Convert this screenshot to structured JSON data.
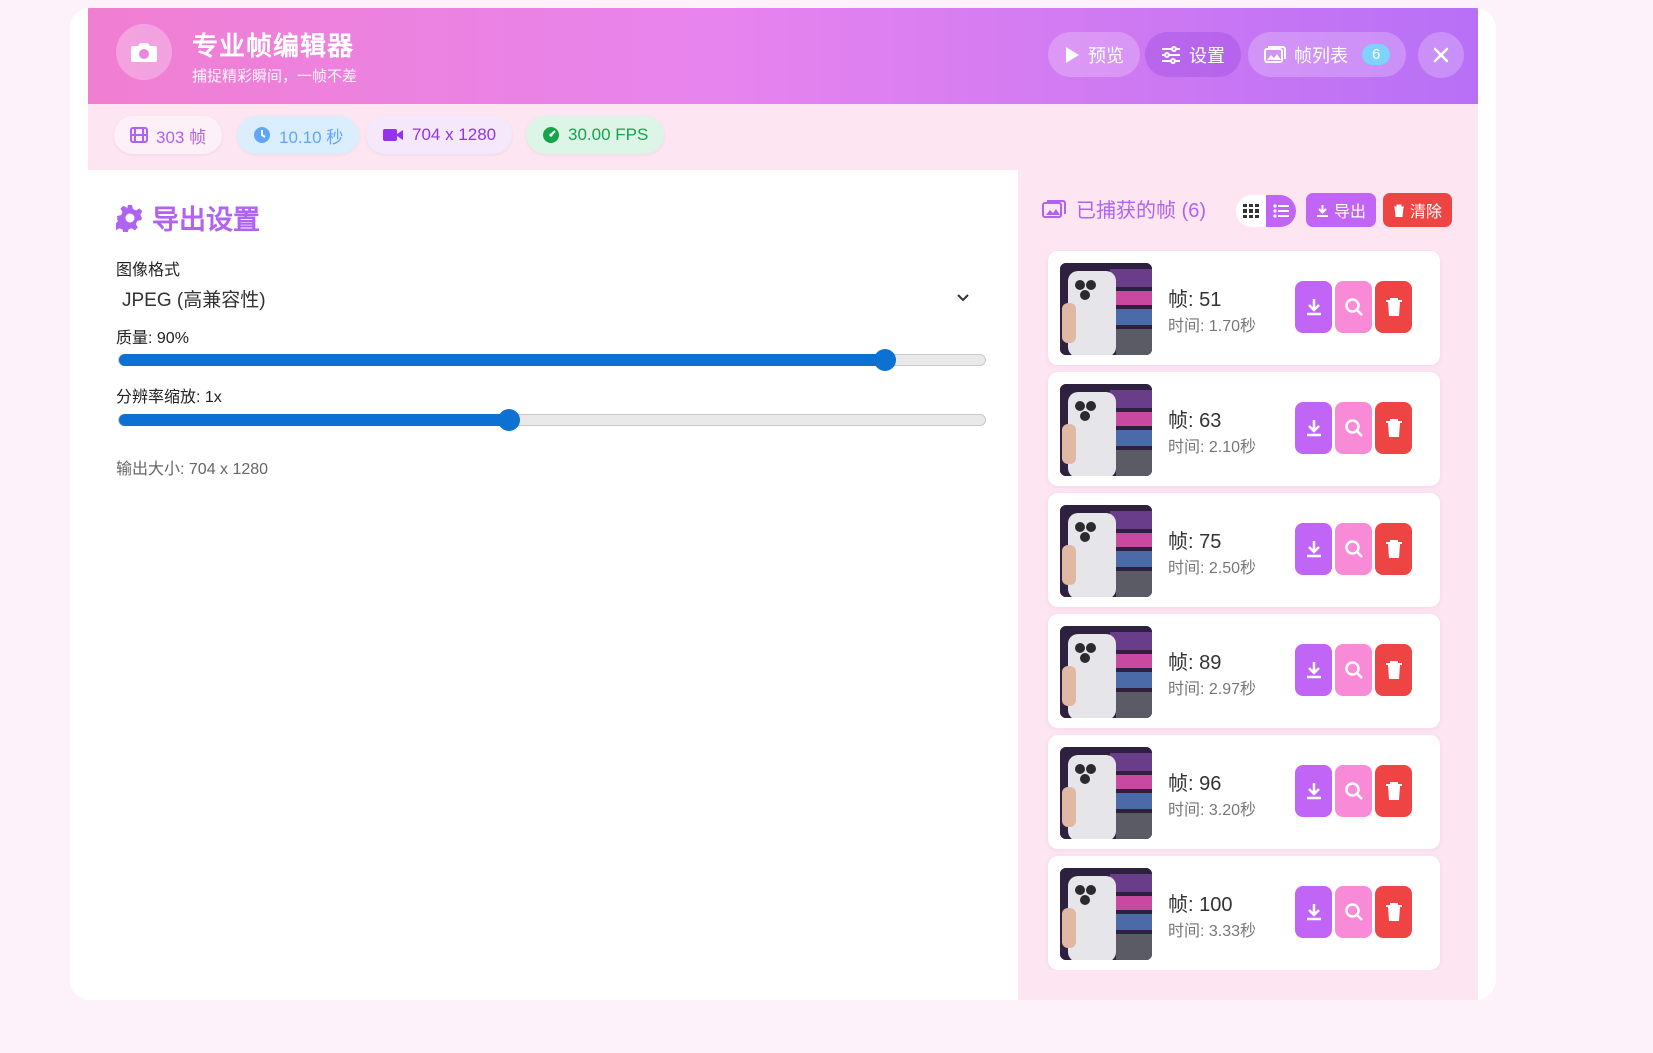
{
  "header": {
    "title": "专业帧编辑器",
    "subtitle": "捕捉精彩瞬间，一帧不差",
    "buttons": {
      "preview": "预览",
      "settings": "设置",
      "frame_list": "帧列表",
      "frame_count": "6"
    }
  },
  "stats": {
    "frames": "303 帧",
    "duration": "10.10 秒",
    "resolution": "704 x 1280",
    "fps": "30.00 FPS"
  },
  "export_settings": {
    "title": "导出设置",
    "format_label": "图像格式",
    "format_value": "JPEG (高兼容性)",
    "quality_label": "质量: 90%",
    "quality_value": 0.9,
    "scale_label": "分辨率缩放: 1x",
    "scale_value": 0.45,
    "output_size": "输出大小: 704 x 1280"
  },
  "captured": {
    "title": "已捕获的帧 (6)",
    "export_label": "导出",
    "clear_label": "清除",
    "frames": [
      {
        "frame": "帧: 51",
        "time": "时间: 1.70秒"
      },
      {
        "frame": "帧: 63",
        "time": "时间: 2.10秒"
      },
      {
        "frame": "帧: 75",
        "time": "时间: 2.50秒"
      },
      {
        "frame": "帧: 89",
        "time": "时间: 2.97秒"
      },
      {
        "frame": "帧: 96",
        "time": "时间: 3.20秒"
      },
      {
        "frame": "帧: 100",
        "time": "时间: 3.33秒"
      }
    ]
  },
  "colors": {
    "accent": "#b062f0",
    "download": "#c065f5",
    "zoom": "#f98ad8",
    "delete": "#ef4444",
    "slider": "#0c71d3"
  }
}
